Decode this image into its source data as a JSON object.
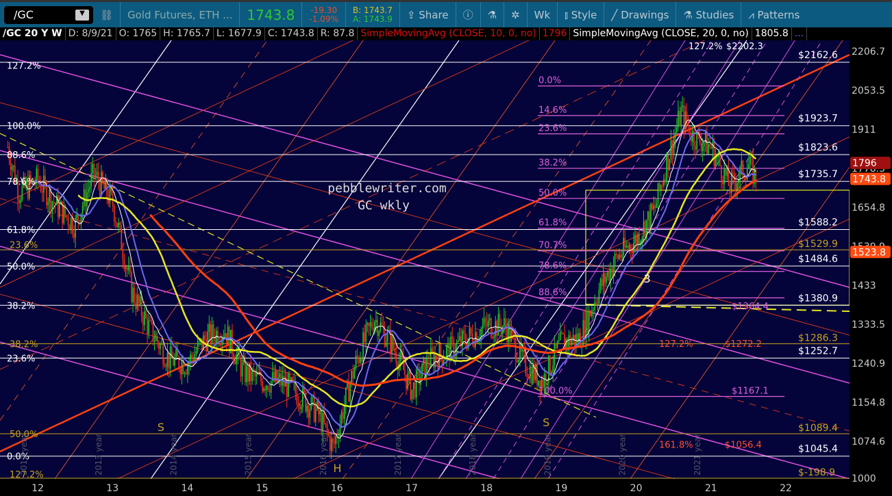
{
  "toolbar": {
    "symbol": "/GC",
    "description": "Gold Futures, ETH ...",
    "last": "1743.8",
    "change": "-19.30",
    "change_pct": "-1.09%",
    "bid": "B: 1743.7",
    "ask": "A: 1743.9",
    "share": "Share",
    "interval": "Wk",
    "style": "Style",
    "drawings": "Drawings",
    "studies": "Studies",
    "patterns": "Patterns"
  },
  "header": {
    "title": "/GC 20 Y W",
    "date": "D: 8/9/21",
    "open": "O: 1765",
    "high": "H: 1765.7",
    "low": "L: 1677.9",
    "close": "C: 1743.8",
    "range": "R: 87.8",
    "sma10": "SimpleMovingAvg (CLOSE, 10, 0, no)",
    "sma10_val": "1796",
    "sma20": "SimpleMovingAvg (CLOSE, 20, 0, no)",
    "sma20_val": "1805.8",
    "more": "..."
  },
  "colors": {
    "bg": "#04043a",
    "white": "#ffffff",
    "gold": "#c8a21a",
    "pink": "#e060e0",
    "red": "#ff3b10",
    "yellow": "#e8e820",
    "blue": "#6a6af0"
  },
  "chart_data": {
    "type": "candlestick",
    "scale": "log",
    "ylim": [
      1000,
      2206.7
    ],
    "xlim": [
      2011.6,
      2022.4
    ],
    "watermark": [
      "pebblewriter.com",
      "GC wkly"
    ],
    "x_ticks": [
      "12",
      "13",
      "14",
      "15",
      "16",
      "17",
      "18",
      "19",
      "20",
      "21",
      "22"
    ],
    "x_tick_years": [
      2012,
      2013,
      2014,
      2015,
      2016,
      2017,
      2018,
      2019,
      2020,
      2021,
      2022
    ],
    "year_labels": [
      "2012 year",
      "2013 year",
      "2014 year",
      "2015 year",
      "2016 year",
      "2017 year",
      "2018 year",
      "2019 year",
      "2020 year",
      "2021 year"
    ],
    "y_ticks": [
      2206.7,
      2053.5,
      1911,
      1778.3,
      1654.8,
      1539.9,
      1433,
      1333.5,
      1240.9,
      1154.8,
      1074.6,
      1000
    ],
    "price_badges": [
      {
        "label": "1796",
        "value": 1796,
        "color": "#a01010"
      },
      {
        "label": "1743.8",
        "value": 1743.8,
        "color": "#ff4a10"
      },
      {
        "label": "1523.8",
        "value": 1523.8,
        "color": "#ff4a10"
      }
    ],
    "price_path": {
      "t": [
        2011.6,
        2011.75,
        2012,
        2012.25,
        2012.5,
        2012.75,
        2013,
        2013.25,
        2013.5,
        2013.75,
        2014,
        2014.25,
        2014.5,
        2014.75,
        2015,
        2015.25,
        2015.5,
        2015.75,
        2015.95,
        2016.25,
        2016.5,
        2016.75,
        2017,
        2017.25,
        2017.5,
        2017.75,
        2018,
        2018.25,
        2018.5,
        2018.75,
        2019,
        2019.25,
        2019.5,
        2019.75,
        2020,
        2020.25,
        2020.6,
        2020.75,
        2021,
        2021.25,
        2021.5,
        2021.6
      ],
      "close": [
        1850,
        1700,
        1740,
        1660,
        1600,
        1760,
        1670,
        1420,
        1320,
        1250,
        1240,
        1300,
        1320,
        1220,
        1200,
        1200,
        1170,
        1130,
        1060,
        1240,
        1350,
        1280,
        1180,
        1250,
        1270,
        1300,
        1330,
        1330,
        1240,
        1200,
        1290,
        1300,
        1420,
        1510,
        1560,
        1650,
        1970,
        1890,
        1850,
        1720,
        1790,
        1743.8
      ]
    },
    "white_levels": [
      {
        "label": "$2162.6",
        "value": 2162.6
      },
      {
        "label": "$1923.7",
        "value": 1923.7
      },
      {
        "label": "$1823.6",
        "value": 1823.6
      },
      {
        "label": "$1735.7",
        "value": 1735.7
      },
      {
        "label": "$1588.2",
        "value": 1588.2
      },
      {
        "label": "$1484.6",
        "value": 1484.6
      },
      {
        "label": "$1380.9",
        "value": 1380.9
      },
      {
        "label": "$1252.7",
        "value": 1252.7
      },
      {
        "label": "$1045.4",
        "value": 1045.4
      }
    ],
    "gold_levels": [
      {
        "label": "$1529.9",
        "value": 1529.9
      },
      {
        "label": "$1286.3",
        "value": 1286.3
      },
      {
        "label": "$1089.4",
        "value": 1089.4
      },
      {
        "label": "$-198.9",
        "value": 1003
      }
    ],
    "left_white_fibs": [
      {
        "label": "127.2%",
        "value": 2150
      },
      {
        "label": "100.0%",
        "value": 1923.7
      },
      {
        "label": "88.6%",
        "value": 1823.6
      },
      {
        "label": "78.6%",
        "value": 1735.7
      },
      {
        "label": "61.8%",
        "value": 1588.2
      },
      {
        "label": "50.0%",
        "value": 1484.6
      },
      {
        "label": "38.2%",
        "value": 1380.9
      },
      {
        "label": "23.6%",
        "value": 1252.7
      },
      {
        "label": "0.0%",
        "value": 1045.4
      }
    ],
    "left_gold_fibs": [
      {
        "label": "23.6%",
        "value": 1545
      },
      {
        "label": "38.2%",
        "value": 1286.3
      },
      {
        "label": "50.0%",
        "value": 1089.4
      },
      {
        "label": "127.2%",
        "value": 1008
      }
    ],
    "pink_fibs": [
      {
        "label": "0.0%",
        "value": 2070
      },
      {
        "label": "14.6%",
        "value": 1960
      },
      {
        "label": "23.6%",
        "value": 1895
      },
      {
        "label": "38.2%",
        "value": 1778
      },
      {
        "label": "50.0%",
        "value": 1682
      },
      {
        "label": "61.8%",
        "value": 1592
      },
      {
        "label": "70.7%",
        "value": 1527
      },
      {
        "label": "78.6%",
        "value": 1470
      },
      {
        "label": "88.6%",
        "value": 1400
      },
      {
        "label": "100.0%",
        "value": 1167.1
      }
    ],
    "pink_values": [
      {
        "label": "$1364.4",
        "value": 1364.4
      },
      {
        "label": "$1167.1",
        "value": 1167.1
      }
    ],
    "red_fibs": [
      {
        "label": "127.2%",
        "value": 1272.2,
        "price": "$1272.2"
      },
      {
        "label": "161.8%",
        "value": 1056.4,
        "price": "$1056.4"
      }
    ],
    "top_fib": {
      "label": "127.2%",
      "price": "$2202.3"
    },
    "annotations": [
      {
        "text": "S",
        "t": 2013.6,
        "value": 1095
      },
      {
        "text": "S",
        "t": 2018.75,
        "value": 1105
      },
      {
        "text": "H",
        "t": 2015.95,
        "value": 1010
      },
      {
        "text": "3",
        "t": 2020.1,
        "value": 1440
      }
    ]
  }
}
